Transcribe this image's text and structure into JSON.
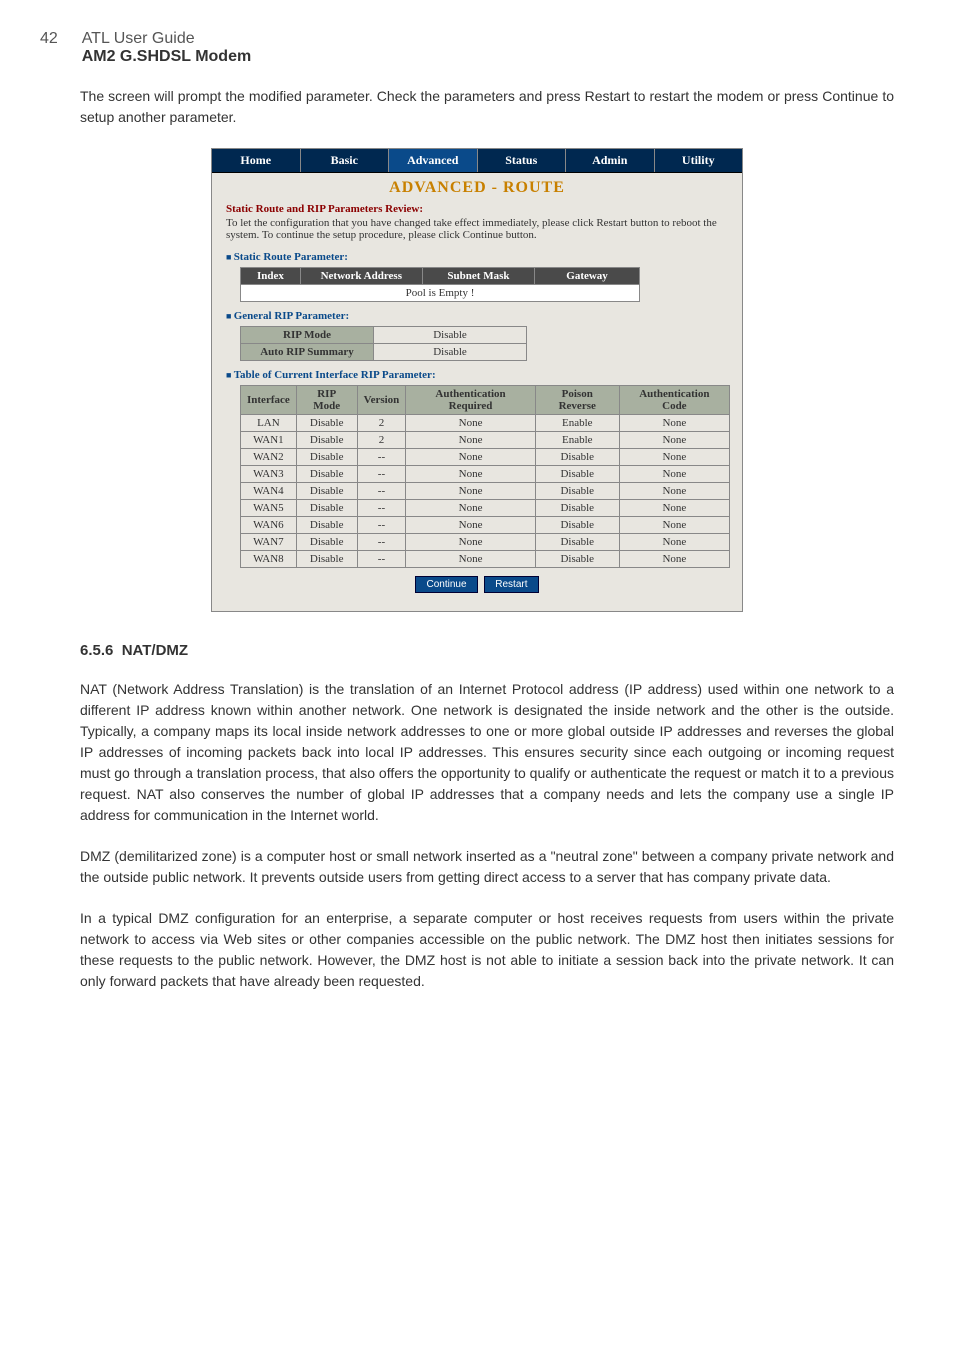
{
  "page_number": "42",
  "guide_title": "ATL User Guide",
  "product_title": "AM2 G.SHDSL Modem",
  "intro_text": "The screen will prompt the modified parameter. Check the parameters and press Restart to restart the modem or press Continue to setup another parameter.",
  "figure": {
    "nav": [
      "Home",
      "Basic",
      "Advanced",
      "Status",
      "Admin",
      "Utility"
    ],
    "active_nav": "Advanced",
    "panel_title": "ADVANCED - ROUTE",
    "review_heading": "Static Route and RIP Parameters Review:",
    "review_text": "To let the configuration that you have changed take effect immediately, please click Restart button to reboot the system. To continue the setup procedure, please click Continue button.",
    "static_h": "Static Route Parameter:",
    "static_headers": [
      "Index",
      "Network Address",
      "Subnet Mask",
      "Gateway"
    ],
    "static_empty": "Pool is Empty !",
    "general_h": "General RIP Parameter:",
    "general_rows": [
      {
        "label": "RIP Mode",
        "value": "Disable"
      },
      {
        "label": "Auto RIP Summary",
        "value": "Disable"
      }
    ],
    "rip_table_h": "Table of Current Interface RIP Parameter:",
    "rip_headers": [
      "Interface",
      "RIP Mode",
      "Version",
      "Authentication Required",
      "Poison Reverse",
      "Authentication Code"
    ],
    "rip_rows": [
      [
        "LAN",
        "Disable",
        "2",
        "None",
        "Enable",
        "None"
      ],
      [
        "WAN1",
        "Disable",
        "2",
        "None",
        "Enable",
        "None"
      ],
      [
        "WAN2",
        "Disable",
        "--",
        "None",
        "Disable",
        "None"
      ],
      [
        "WAN3",
        "Disable",
        "--",
        "None",
        "Disable",
        "None"
      ],
      [
        "WAN4",
        "Disable",
        "--",
        "None",
        "Disable",
        "None"
      ],
      [
        "WAN5",
        "Disable",
        "--",
        "None",
        "Disable",
        "None"
      ],
      [
        "WAN6",
        "Disable",
        "--",
        "None",
        "Disable",
        "None"
      ],
      [
        "WAN7",
        "Disable",
        "--",
        "None",
        "Disable",
        "None"
      ],
      [
        "WAN8",
        "Disable",
        "--",
        "None",
        "Disable",
        "None"
      ]
    ],
    "buttons": {
      "continue": "Continue",
      "restart": "Restart"
    }
  },
  "section": {
    "number": "6.5.6",
    "title": "NAT/DMZ",
    "p1": "NAT (Network Address Translation) is the translation of an Internet Protocol address (IP address) used within one network to a different IP address known within another network. One network is designated the inside network and the other is the outside. Typically, a company maps its local inside network addresses to one or more global outside IP addresses and reverses the global IP addresses of incoming packets back into local IP addresses. This ensures security since each outgoing or incoming request must go through a translation process, that also offers the opportunity to qualify or authenticate the request or match it to a previous request. NAT also conserves the number of global IP addresses that a company needs and lets the company use a single IP address for communication in the Internet world.",
    "p2": "DMZ (demilitarized zone) is a computer host or small network inserted as a \"neutral zone\" between a company private network and the outside public network. It prevents outside users from getting direct access to a server that has company private data.",
    "p3": "In a typical DMZ configuration for an enterprise, a separate computer or host receives requests from users within the private network to access via Web sites or other companies accessible on the public network. The DMZ host then initiates sessions for these requests to the public network. However, the DMZ host is not able to initiate a session back into the private network. It can only forward packets that have already been requested."
  }
}
